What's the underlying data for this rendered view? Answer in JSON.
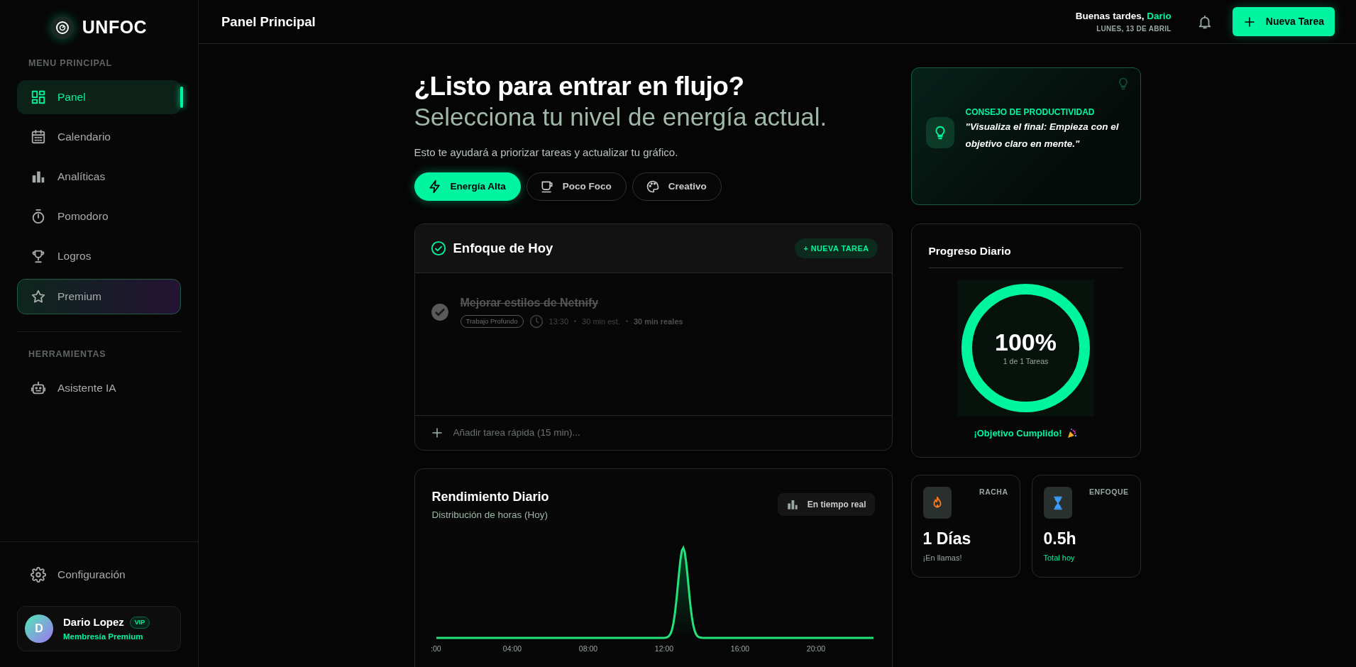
{
  "brand": {
    "name": "UNFOC"
  },
  "sidebar": {
    "sections": [
      {
        "title": "MENU PRINCIPAL",
        "items": [
          {
            "label": "Panel",
            "kind": "link",
            "selected": true
          },
          {
            "label": "Calendario",
            "kind": "link",
            "selected": false
          },
          {
            "label": "Analíticas",
            "kind": "link",
            "selected": false
          },
          {
            "label": "Pomodoro",
            "kind": "link",
            "selected": false
          },
          {
            "label": "Logros",
            "kind": "link",
            "selected": false
          },
          {
            "label": "Premium",
            "kind": "premium",
            "selected": false
          }
        ]
      },
      {
        "title": "HERRAMIENTAS",
        "items": [
          {
            "label": "Asistente IA",
            "kind": "link",
            "selected": false
          }
        ]
      }
    ],
    "settings": "Configuración",
    "user": {
      "initial": "D",
      "name": "Dario Lopez",
      "badge": "VIP",
      "plan": "Membresía Premium"
    }
  },
  "header": {
    "title": "Panel Principal",
    "greeting": "Buenas tardes,",
    "user_name": "Dario",
    "date": "LUNES, 13 DE ABRIL",
    "new_task_button": "Nueva Tarea"
  },
  "hero": {
    "title": "¿Listo para entrar en flujo?",
    "subtitle": "Selecciona tu nivel de energía actual.",
    "description": "Esto te ayudará a priorizar tareas y actualizar tu gráfico.",
    "energy_options": [
      {
        "label": "Energía Alta",
        "selected": true
      },
      {
        "label": "Poco Foco",
        "selected": false
      },
      {
        "label": "Creativo",
        "selected": false
      }
    ]
  },
  "focus": {
    "title": "Enfoque de Hoy",
    "add_button": "+ NUEVA TAREA",
    "tasks": [
      {
        "title": "Mejorar estilos de Netnify",
        "done": true,
        "tag": "Trabajo Profundo",
        "time": "13:30",
        "estimate": "30 min est.",
        "actual": "30 min reales"
      }
    ],
    "quick_add": {
      "placeholder": "Añadir tarea rápida (15 min)..."
    }
  },
  "performance": {
    "title": "Rendimiento Diario",
    "subtitle": "Distribución de horas (Hoy)",
    "badge": "En tiempo real",
    "x_labels": [
      ":00",
      "04:00",
      "08:00",
      "12:00",
      "16:00",
      "20:00"
    ]
  },
  "tip": {
    "label": "CONSEJO DE PRODUCTIVIDAD",
    "quote": "\"Visualiza el final: Empieza con el objetivo claro en mente.\""
  },
  "progress": {
    "title": "Progreso Diario",
    "level": 1.0,
    "percent": "100%",
    "detail": "1 de 1 Tareas",
    "message": "¡Objetivo Cumplido!"
  },
  "stats": [
    {
      "label": "RACHA",
      "value": "1 Días",
      "caption": "¡En llamas!",
      "color": "#9aa9a0"
    },
    {
      "label": "ENFOQUE",
      "value": "0.5h",
      "caption": "Total hoy",
      "color": "#00f5a0"
    }
  ]
}
